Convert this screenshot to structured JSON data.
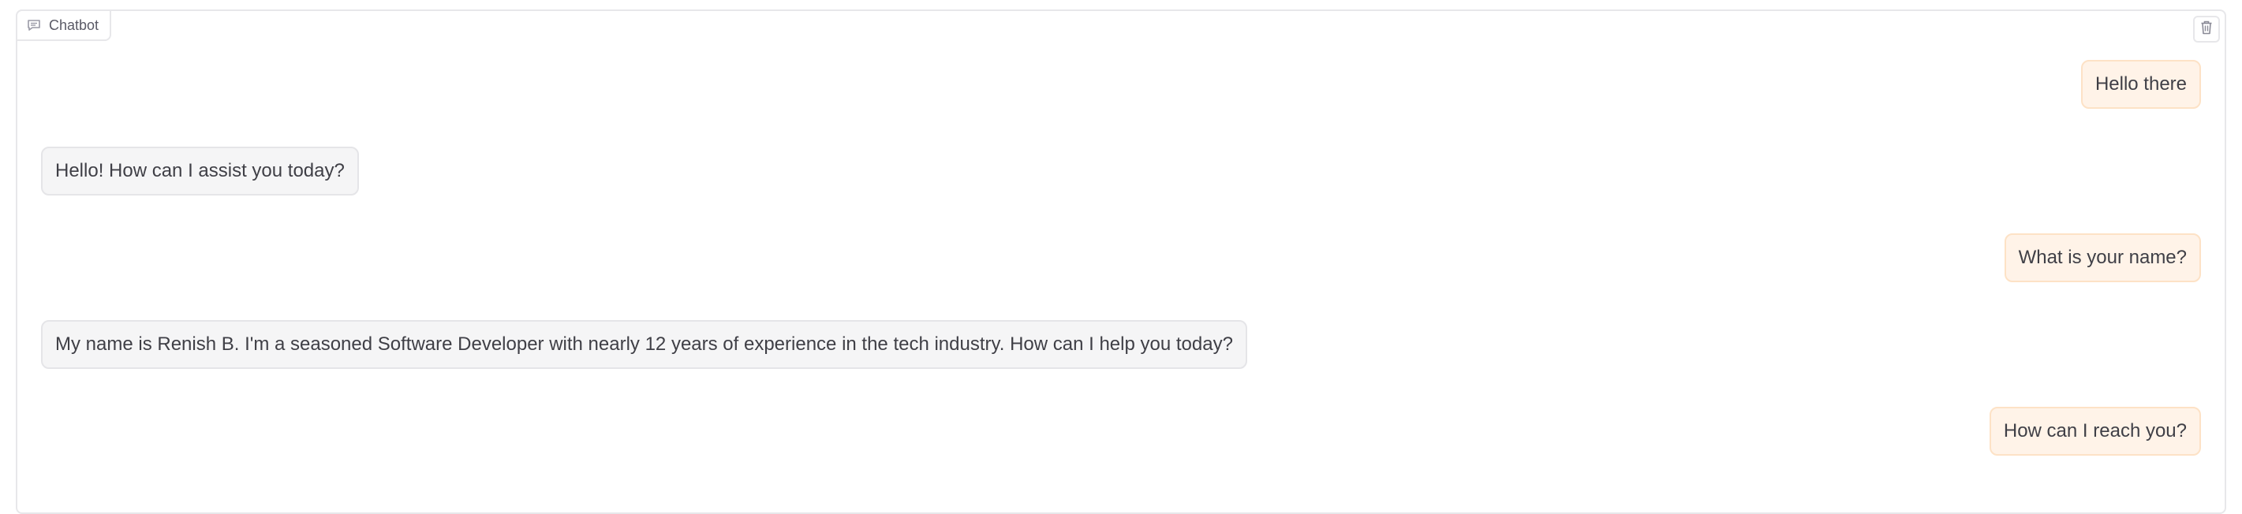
{
  "chatbot": {
    "label": "Chatbot",
    "icons": {
      "label_icon": "chat-icon",
      "clear_icon": "trash-icon"
    },
    "messages": [
      {
        "role": "user",
        "text": "Hello there"
      },
      {
        "role": "bot",
        "text": "Hello! How can I assist you today?"
      },
      {
        "role": "user",
        "text": "What is your name?"
      },
      {
        "role": "bot",
        "text": "My name is Renish B. I'm a seasoned Software Developer with nearly 12 years of experience in the tech industry. How can I help you today?"
      },
      {
        "role": "user",
        "text": "How can I reach you?"
      }
    ]
  },
  "colors": {
    "user_bubble": "#fff3e8",
    "user_border": "#fde2c6",
    "bot_bubble": "#f5f5f6",
    "bot_border": "#e5e5e8",
    "text": "#3f3f46"
  }
}
